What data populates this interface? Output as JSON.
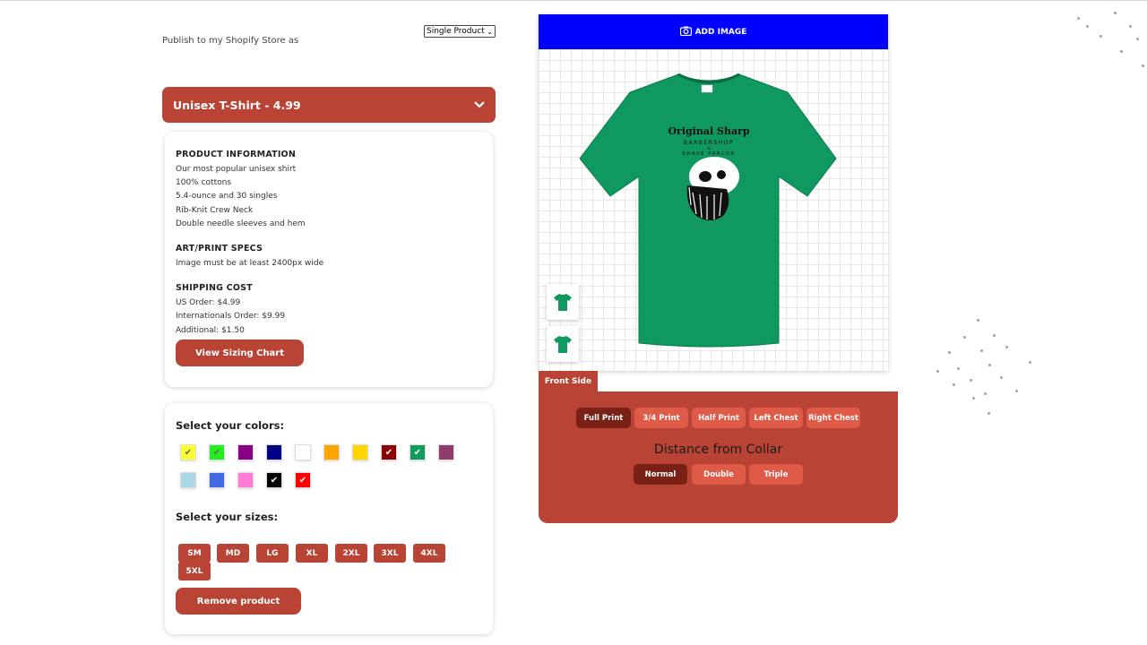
{
  "publish": {
    "label": "Publish to my Shopify Store as",
    "selected": "Single Product"
  },
  "product": {
    "header": "Unisex T-Shirt - 4.99",
    "info_title": "PRODUCT INFORMATION",
    "info_lines": [
      "Our most popular unisex shirt",
      "100% cottons",
      "5.4-ounce and 30 singles",
      "Rib-Knit Crew Neck",
      "Double needle sleeves and hem"
    ],
    "specs_title": "ART/PRINT SPECS",
    "specs_lines": [
      "Image must be at least 2400px wide"
    ],
    "shipping_title": "SHIPPING COST",
    "shipping_lines": [
      "US Order: $4.99",
      "Internationals Order: $9.99",
      "Additional: $1.50"
    ],
    "sizing_button": "View Sizing Chart"
  },
  "colors": {
    "title": "Select your colors:",
    "swatches": [
      {
        "name": "yellow",
        "hex": "#ffff33",
        "checked": true
      },
      {
        "name": "lime",
        "hex": "#22ee22",
        "checked": true
      },
      {
        "name": "purple",
        "hex": "#880088",
        "checked": false
      },
      {
        "name": "navy",
        "hex": "#000088",
        "checked": false
      },
      {
        "name": "white",
        "hex": "#ffffff",
        "checked": false
      },
      {
        "name": "orange",
        "hex": "#ffa500",
        "checked": false
      },
      {
        "name": "gold",
        "hex": "#ffd700",
        "checked": false
      },
      {
        "name": "maroon",
        "hex": "#8b0000",
        "checked": true
      },
      {
        "name": "kelly-green",
        "hex": "#0f9d58",
        "checked": true
      },
      {
        "name": "heather-purple",
        "hex": "#8e3a6b",
        "checked": false
      },
      {
        "name": "light-blue",
        "hex": "#add8e6",
        "checked": false
      },
      {
        "name": "royal-blue",
        "hex": "#4169e1",
        "checked": false
      },
      {
        "name": "pink",
        "hex": "#ff7bd5",
        "checked": false
      },
      {
        "name": "black",
        "hex": "#000000",
        "checked": true
      },
      {
        "name": "red",
        "hex": "#ff0000",
        "checked": true
      }
    ]
  },
  "sizes": {
    "title": "Select your sizes:",
    "options": [
      "SM",
      "MD",
      "LG",
      "XL",
      "2XL",
      "3XL",
      "4XL",
      "5XL"
    ]
  },
  "remove_button": "Remove product",
  "designer": {
    "add_image": "ADD IMAGE",
    "side_tab": "Front Side",
    "print_options": [
      "Full Print",
      "3/4 Print",
      "Half Print",
      "Left Chest",
      "Right Chest"
    ],
    "print_selected": "Full Print",
    "collar_title": "Distance from Collar",
    "collar_options": [
      "Normal",
      "Double",
      "Triple"
    ],
    "collar_selected": "Normal",
    "shirt_color": "#0f9960",
    "print_text_1": "Original Sharp",
    "print_text_2": "BARBERSHOP",
    "print_text_3": "&",
    "print_text_4": "SHAVE PARLOR"
  },
  "colors_theme": {
    "accent": "#b94435",
    "accent_dark": "#7a2116",
    "pill": "#e05a48",
    "blue_bar": "#0000ff"
  }
}
